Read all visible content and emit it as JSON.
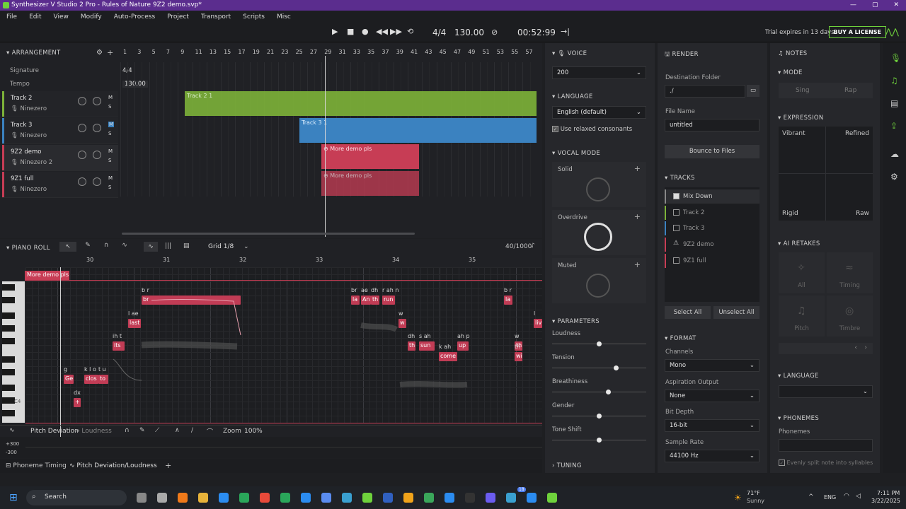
{
  "window": {
    "title": "Synthesizer V Studio 2 Pro - Rules of Nature 9Z2 demo.svp*",
    "controls": [
      "—",
      "▢",
      "✕"
    ]
  },
  "menu": [
    "File",
    "Edit",
    "View",
    "Modify",
    "Auto-Process",
    "Project",
    "Transport",
    "Scripts",
    "Misc"
  ],
  "transport": {
    "time_signature": "4/4",
    "tempo": "130.00",
    "time": "00:52:99",
    "trial": "Trial expires in 13 days",
    "license": "BUY A LICENSE"
  },
  "arrangement": {
    "title": "ARRANGEMENT",
    "ruler": [
      "1",
      "3",
      "5",
      "7",
      "9",
      "11",
      "13",
      "15",
      "17",
      "19",
      "21",
      "23",
      "25",
      "27",
      "29",
      "31",
      "33",
      "35",
      "37",
      "39",
      "41",
      "43",
      "45",
      "47",
      "49",
      "51",
      "53",
      "55",
      "57"
    ],
    "signature_label": "Signature",
    "signature": "4/4",
    "tempo_label": "Tempo",
    "tempo": "130.00",
    "tracks": [
      {
        "name": "Track 2",
        "voice": "Ninezero",
        "color": "#7db239"
      },
      {
        "name": "Track 3",
        "voice": "Ninezero",
        "color": "#3b82c0"
      },
      {
        "name": "9Z2 demo",
        "voice": "Ninezero 2",
        "color": "#c73d55"
      },
      {
        "name": "9Z1 full",
        "voice": "Ninezero",
        "color": "#c73d55"
      }
    ],
    "mute": "M",
    "solo": "S",
    "clips": [
      {
        "label": "Track 2 1"
      },
      {
        "label": "Track 3 1"
      },
      {
        "label": "More demo pls"
      },
      {
        "label": "More demo pls"
      }
    ]
  },
  "piano_roll": {
    "title": "PIANO ROLL",
    "grid": "Grid 1/8",
    "count": "40/1000",
    "ruler": [
      "30",
      "31",
      "32",
      "33",
      "34",
      "35"
    ],
    "clip_label": "More demo pls",
    "c4": "C4",
    "notes": [
      {
        "lyric": "br",
        "ph": "b r"
      },
      {
        "lyric": "last",
        "ph": "l ae"
      },
      {
        "lyric": "its",
        "ph": "ih t"
      },
      {
        "lyric": "Ge",
        "ph": "g"
      },
      {
        "lyric": "clos",
        "ph": "k l o"
      },
      {
        "lyric": "to",
        "ph": "t u"
      },
      {
        "lyric": "+",
        "ph": "dx"
      },
      {
        "lyric": "la",
        "ph": "br"
      },
      {
        "lyric": "An",
        "ph": "ae"
      },
      {
        "lyric": "th",
        "ph": "dh"
      },
      {
        "lyric": "run",
        "ph": "r ah n"
      },
      {
        "lyric": "w",
        "ph": "w"
      },
      {
        "lyric": "th",
        "ph": "dh"
      },
      {
        "lyric": "sun",
        "ph": "s ah"
      },
      {
        "lyric": "come",
        "ph": "k ah"
      },
      {
        "lyric": "up",
        "ph": "ah p"
      },
      {
        "lyric": "la",
        "ph": "b r"
      },
      {
        "lyric": "th",
        "ph": "w"
      },
      {
        "lyric": "wi",
        "ph": "th"
      },
      {
        "lyric": "liv",
        "ph": "l"
      }
    ],
    "param_tab": "Pitch Deviation",
    "param_tab2": "Loudness",
    "zoom_label": "Zoom",
    "zoom": "100%",
    "axis_top": "+300",
    "axis_bottom": "-300",
    "bottom_tabs": [
      "Phoneme Timing",
      "Pitch Deviation/Loudness"
    ]
  },
  "voice": {
    "title": "VOICE",
    "value": "200",
    "language_title": "LANGUAGE",
    "language": "English (default)",
    "relaxed": "Use relaxed consonants",
    "vocal_mode_title": "VOCAL MODE",
    "modes": [
      "Solid",
      "Overdrive",
      "Muted"
    ],
    "parameters_title": "PARAMETERS",
    "params": [
      {
        "name": "Loudness",
        "value": 0.5
      },
      {
        "name": "Tension",
        "value": 0.68
      },
      {
        "name": "Breathiness",
        "value": 0.6
      },
      {
        "name": "Gender",
        "value": 0.5
      },
      {
        "name": "Tone Shift",
        "value": 0.5
      }
    ],
    "tuning_title": "TUNING"
  },
  "render": {
    "title": "RENDER",
    "dest_label": "Destination Folder",
    "dest": "./",
    "file_label": "File Name",
    "file": "untitled",
    "bounce": "Bounce to Files",
    "tracks_title": "TRACKS",
    "tracks": [
      "Mix Down",
      "Track 2",
      "Track 3",
      "9Z2 demo",
      "9Z1 full"
    ],
    "select_all": "Select All",
    "unselect_all": "Unselect All",
    "format_title": "FORMAT",
    "channels_label": "Channels",
    "channels": "Mono",
    "aspiration_label": "Aspiration Output",
    "aspiration": "None",
    "bitdepth_label": "Bit Depth",
    "bitdepth": "16-bit",
    "samplerate_label": "Sample Rate",
    "samplerate": "44100 Hz"
  },
  "notes_panel": {
    "title": "NOTES",
    "mode_title": "MODE",
    "sing": "Sing",
    "rap": "Rap",
    "expression_title": "EXPRESSION",
    "vibrant": "Vibrant",
    "refined": "Refined",
    "rigid": "Rigid",
    "raw": "Raw",
    "retakes_title": "AI RETAKES",
    "retakes": [
      "All",
      "Timing",
      "Pitch",
      "Timbre"
    ],
    "language_title": "LANGUAGE",
    "phonemes_title": "PHONEMES",
    "phonemes_label": "Phonemes",
    "split": "Evenly split note into syllables"
  },
  "taskbar": {
    "search": "Search",
    "weather_temp": "71°F",
    "weather": "Sunny",
    "lang": "ENG",
    "time": "7:11 PM",
    "date": "3/22/2025",
    "badge": "18"
  }
}
